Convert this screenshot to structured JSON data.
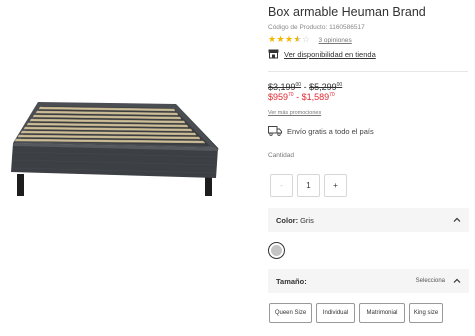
{
  "product": {
    "title": "Box armable Heuman Brand",
    "code": "Código de Producto: 1160586517",
    "rating": {
      "value": 3.5,
      "max": 5,
      "opinions": "3 opiniones"
    },
    "store_link": "Ver disponibilidad en tienda"
  },
  "price": {
    "old_low": "$3,199",
    "old_low_cents": "00",
    "old_high": "$5,299",
    "old_high_cents": "00",
    "dash": " - ",
    "new_low": "$959",
    "new_low_cents": "70",
    "new_high": "$1,589",
    "new_high_cents": "70"
  },
  "promos_link": "Ver más promociones",
  "shipping_text": "Envío gratis a todo el país",
  "quantity": {
    "label": "Cantidad",
    "minus": "-",
    "value": "1",
    "plus": "+"
  },
  "color": {
    "label": "Color:",
    "value": "Gris",
    "swatch_color": "#c4c4c4"
  },
  "size": {
    "label": "Tamaño:",
    "select_text": "Selecciona",
    "options": [
      "Queen Size",
      "Individual",
      "Matrimonial",
      "King size"
    ]
  },
  "colors": {
    "accent_red": "#e3262f",
    "star_yellow": "#f2b600",
    "panel_bg": "#f5f5f5"
  },
  "icons": [
    "bed-frame-image",
    "store-icon",
    "truck-icon",
    "chevron-up-icon"
  ]
}
